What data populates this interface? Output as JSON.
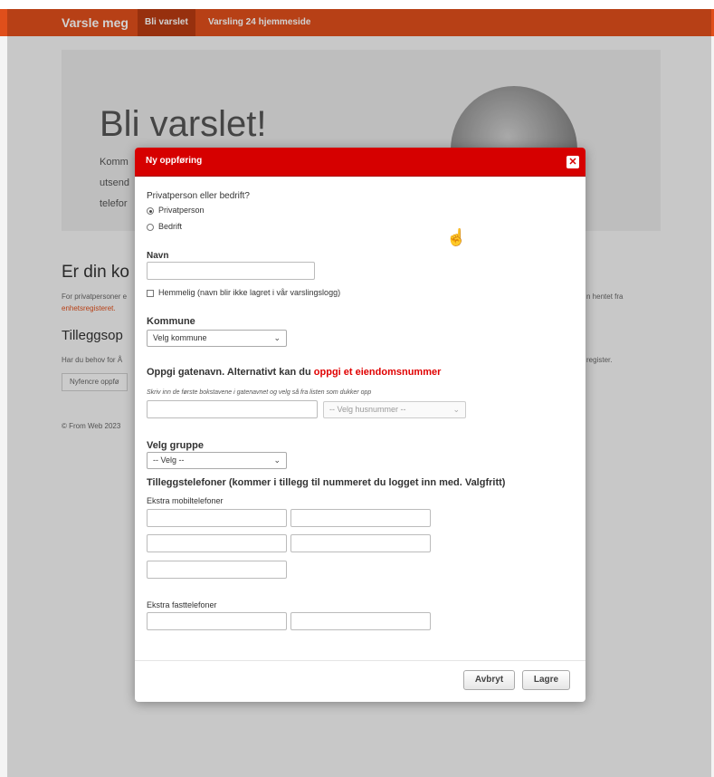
{
  "navbar": {
    "brand": "Varsle meg",
    "items": [
      "Bli varslet",
      "Varsling 24 hjemmeside"
    ]
  },
  "background": {
    "jumbo_title": "Bli varslet!",
    "jumbo_lines": [
      "Komm",
      "utsend",
      "telefor"
    ],
    "section_heading": "Er din ko",
    "section_text": "For privatpersoner e",
    "section_text_right": "n hentet fra",
    "section_link": "enhetsregisteret.",
    "sub_heading": "Tilleggsop",
    "sub_text": "Har du behov for Å",
    "sub_text_right": "register.",
    "renew_button": "Nyfencre oppfø",
    "footer": "© From Web 2023"
  },
  "modal": {
    "title": "Ny oppføring",
    "close_icon": "close-icon",
    "type_question": "Privatperson eller bedrift?",
    "type_options": [
      {
        "label": "Privatperson",
        "checked": true
      },
      {
        "label": "Bedrift",
        "checked": false
      }
    ],
    "name_label": "Navn",
    "name_value": "",
    "secret_label": "Hemmelig (navn blir ikke lagret i vår varslingslogg)",
    "municipality_label": "Kommune",
    "municipality_selected": "Velg kommune",
    "street_label": "Oppgi gatenavn. Alternativt kan du ",
    "street_link": "oppgi et eiendomsnummer",
    "street_hint": "Skriv inn de første bokstavene i gatenavnet og velg så fra listen som dukker opp",
    "street_value": "",
    "house_number_selected": "-- Velg husnummer --",
    "group_label": "Velg gruppe",
    "group_selected": "-- Velg --",
    "extra_phones_label": "Tilleggstelefoner (kommer i tillegg til nummeret du logget inn med. Valgfritt)",
    "mobile_label": "Ekstra mobiltelefoner",
    "landline_label": "Ekstra fasttelefoner",
    "cancel_button": "Avbryt",
    "save_button": "Lagre"
  }
}
